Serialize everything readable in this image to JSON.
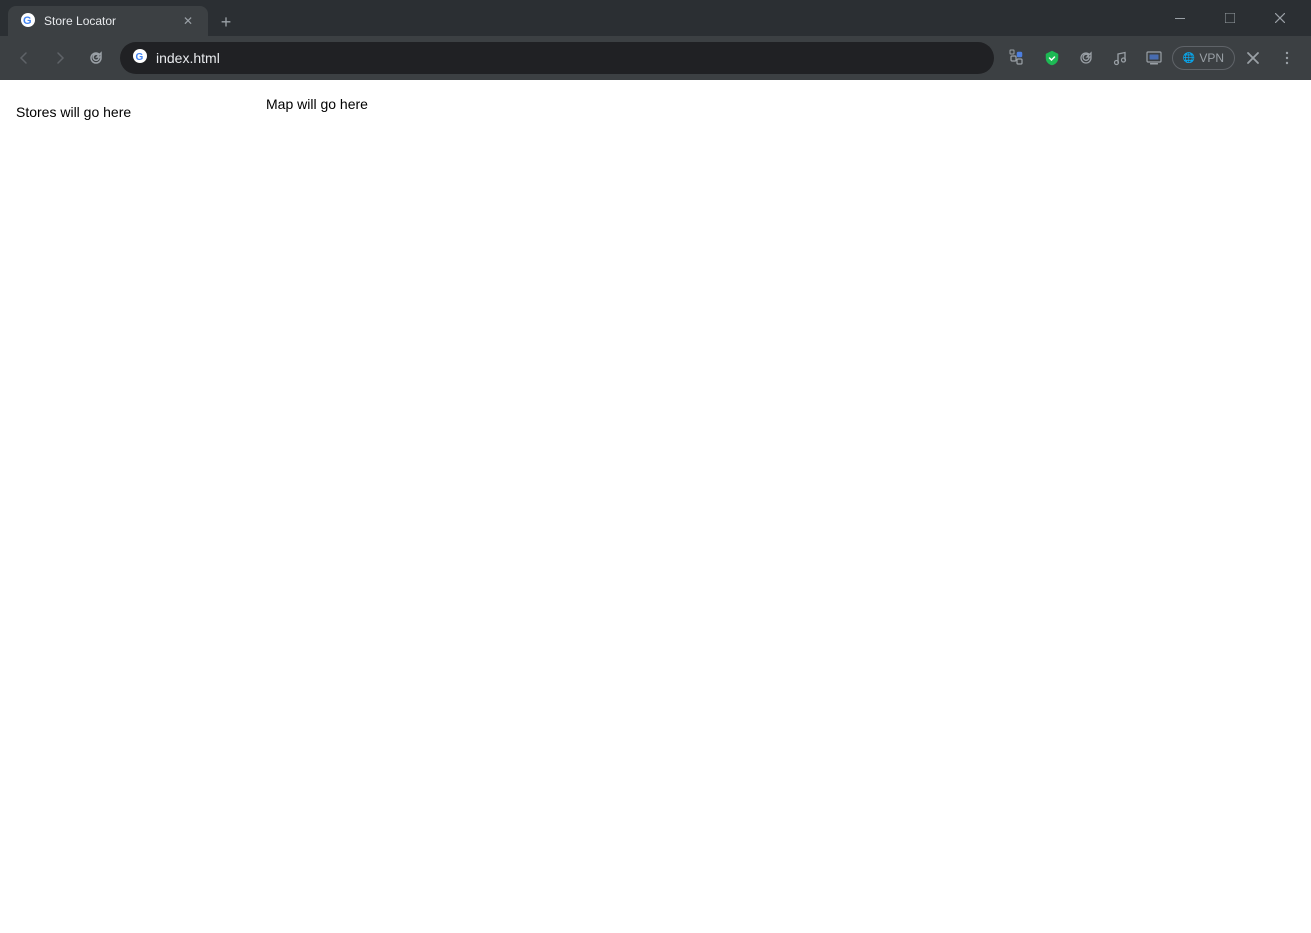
{
  "browser": {
    "tab": {
      "title": "Store Locator",
      "favicon": "🌐"
    },
    "new_tab_label": "+",
    "address_bar": {
      "url": "index.html",
      "favicon": "G"
    },
    "window_controls": {
      "minimize": "—",
      "restore": "❐",
      "close": "✕"
    },
    "nav": {
      "back": "‹",
      "forward": "›",
      "reload": "↻"
    },
    "toolbar_icons": {
      "extensions": "🔧",
      "shield": "🛡",
      "refresh_ext": "↺",
      "music": "♪",
      "cast": "⬜",
      "vpn_label": "VPN",
      "close_ext": "✕",
      "menu": "≡"
    }
  },
  "page": {
    "map_placeholder": "Map will go here",
    "stores_placeholder": "Stores will go here"
  }
}
